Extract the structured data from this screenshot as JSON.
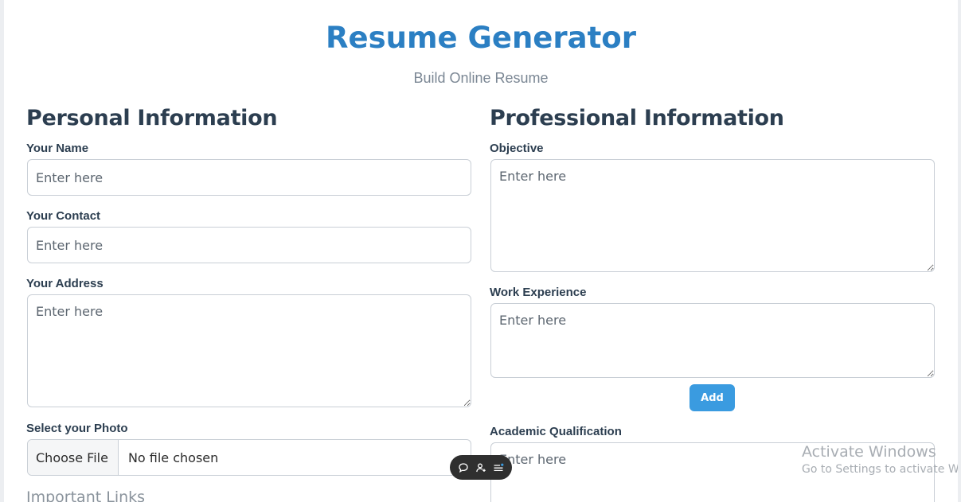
{
  "header": {
    "title": "Resume Generator",
    "subtitle": "Build Online Resume"
  },
  "personal": {
    "heading": "Personal Information",
    "name_label": "Your Name",
    "contact_label": "Your Contact",
    "address_label": "Your Address",
    "photo_label": "Select your Photo",
    "placeholder": "Enter here",
    "file_button": "Choose File",
    "file_status": "No file chosen",
    "links_heading": "Important Links"
  },
  "professional": {
    "heading": "Professional Information",
    "objective_label": "Objective",
    "work_label": "Work Experience",
    "add_button": "Add",
    "academic_label": "Academic Qualification",
    "placeholder": "Enter here"
  },
  "toolbar": {
    "icons": [
      "comment-icon",
      "add-user-icon",
      "menu-icon"
    ]
  },
  "watermark": {
    "line1": "Activate Windows",
    "line2": "Go to Settings to activate Windows."
  },
  "colors": {
    "accent": "#2b7fc3",
    "heading": "#2c3e50",
    "button": "#3a9be0"
  }
}
